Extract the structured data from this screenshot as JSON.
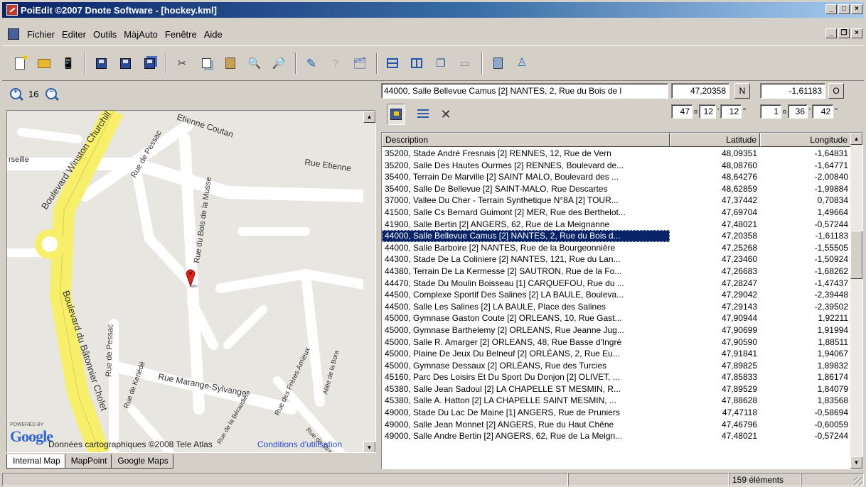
{
  "window": {
    "title": "PoiEdit ©2007 Dnote Software - [hockey.kml]",
    "buttons": {
      "minimize": "_",
      "maximize": "□",
      "close": "×"
    },
    "mdi_buttons": {
      "minimize": "_",
      "restore": "❐",
      "close": "×"
    }
  },
  "menu": [
    "Fichier",
    "Editer",
    "Outils",
    "MàjAuto",
    "Fenêtre",
    "Aide"
  ],
  "toolbar": {
    "icons": [
      "new-file-icon",
      "open-folder-icon",
      "import-icon",
      "save-icon",
      "save-as-icon",
      "save-all-icon",
      "cut-icon",
      "copy-icon",
      "paste-icon",
      "find-icon",
      "find-next-icon",
      "pin-icon",
      "info-icon",
      "properties-icon",
      "single-pane-icon",
      "split-pane-icon",
      "duplicate-icon",
      "tool-icon",
      "calculator-icon",
      "user-icon"
    ]
  },
  "zoom": {
    "level": "16",
    "in_label": "+",
    "out_label": "−"
  },
  "map": {
    "powered_by": "POWERED BY",
    "logo": "Google",
    "credit": "Données cartographiques ©2008 Tele Atlas",
    "terms": "Conditions d'utilisation",
    "streets": [
      "Boulevard Winston Churchill",
      "Rue de Pessac",
      "Etienne Coutan",
      "Rue Etienne",
      "Rue du Bois de la Musse",
      "Boulevard du Bâtonnier Cholet",
      "Rue de Pessac",
      "Rue de Kerlédé",
      "Rue Marange-Sylvange",
      "Allée de la Bora",
      "Rue des Frères Amieux",
      "Rue de Strasbourg",
      "Rue de la Béraudière",
      "rseille"
    ]
  },
  "map_tabs": [
    "Internal Map",
    "MapPoint",
    "Google Maps"
  ],
  "selected": {
    "description": "44000, Salle Bellevue Camus [2] NANTES, 2,  Rue du Bois de l",
    "latitude": "47,20358",
    "lat_hemisphere": "N",
    "longitude": "-1,61183",
    "lon_hemisphere": "O",
    "lat_deg": "47",
    "lat_min": "12",
    "lat_sec": "12",
    "lon_deg": "1",
    "lon_min": "36",
    "lon_sec": "42",
    "deg_sym": "o",
    "min_sym": "'",
    "sec_sym": "\""
  },
  "table": {
    "headers": {
      "description": "Description",
      "latitude": "Latitude",
      "longitude": "Longitude"
    },
    "selected_index": 8,
    "rows": [
      [
        "35200, Stade André Fresnais [2] RENNES, 12, Rue de Vern",
        "48,09351",
        "-1,64831"
      ],
      [
        "35200, Salle Des Hautes Ourmes [2] RENNES, Boulevard de...",
        "48,08760",
        "-1,64771"
      ],
      [
        "35400, Terrain De Marville [2] SAINT MALO, Boulevard des ...",
        "48,64276",
        "-2,00840"
      ],
      [
        "35400, Salle De Bellevue [2] SAINT-MALO, Rue Descartes",
        "48,62859",
        "-1,99884"
      ],
      [
        "37000, Vallee Du Cher - Terrain Synthetique N°8A [2] TOUR...",
        "47,37442",
        "0,70834"
      ],
      [
        "41500, Salle Cs Bernard Guimont [2] MER, Rue des Berthelot...",
        "47,69704",
        "1,49664"
      ],
      [
        "41900, Salle Bertin [2] ANGERS, 62, Rue de La Meignanne",
        "47,48021",
        "-0,57244"
      ],
      [
        "44000, Salle Bellevue Camus [2] NANTES, 2,  Rue du Bois d...",
        "47,20358",
        "-1,61183"
      ],
      [
        "44000, Salle Barboire [2] NANTES, Rue de la Bourgeonnière",
        "47,25268",
        "-1,55505"
      ],
      [
        "44300, Stade De La Coliniere [2] NANTES, 121,  Rue du Lan...",
        "47,23460",
        "-1,50924"
      ],
      [
        "44380, Terrain De La Kermesse [2] SAUTRON, Rue de la Fo...",
        "47,26683",
        "-1,68262"
      ],
      [
        "44470, Stade Du Moulin Boisseau [1] CARQUEFOU, Rue du ...",
        "47,28247",
        "-1,47437"
      ],
      [
        "44500, Complexe Sportif Des Salines [2] LA BAULE, Bouleva...",
        "47,29042",
        "-2,39448"
      ],
      [
        "44500, Salle Les Salines [2] LA BAULE, Place des Salines",
        "47,29143",
        "-2,39502"
      ],
      [
        "45000, Gymnase Gaston Coute [2] ORLEANS, 10,  Rue Gast...",
        "47,90944",
        "1,92211"
      ],
      [
        "45000, Gymnase Barthelemy [2] ORLEANS, Rue Jeanne Jug...",
        "47,90699",
        "1,91994"
      ],
      [
        "45000, Salle R. Amarger [2] ORLEANS, 48,  Rue Basse d'Ingré",
        "47,90590",
        "1,88511"
      ],
      [
        "45000, Plaine De Jeux Du Belneuf [2] ORLÉANS, 2, Rue Eu...",
        "47,91841",
        "1,94067"
      ],
      [
        "45000, Gymnase Dessaux [2] ORLÉANS, Rue des Turcies",
        "47,89825",
        "1,89832"
      ],
      [
        "45160, Parc Des Loisirs Et Du Sport Du Donjon [2] OLIVET, ...",
        "47,85833",
        "1,86174"
      ],
      [
        "45380, Salle Jean Sadoul [2] LA CHAPELLE ST MESMIN, R...",
        "47,89529",
        "1,84079"
      ],
      [
        "45380, Salle A. Hatton [2] LA CHAPELLE SAINT MESMIN, ...",
        "47,88628",
        "1,83568"
      ],
      [
        "49000, Stade Du Lac De Maine [1] ANGERS, Rue de Pruniers",
        "47,47118",
        "-0,58694"
      ],
      [
        "49000, Salle Jean Monnet [2] ANGERS, Rue du Haut Chêne",
        "47,46796",
        "-0,60059"
      ],
      [
        "49000, Salle Andre Bertin [2] ANGERS, 62, Rue de La Meign...",
        "47,48021",
        "-0,57244"
      ]
    ]
  },
  "status": {
    "count": "159 éléments"
  }
}
